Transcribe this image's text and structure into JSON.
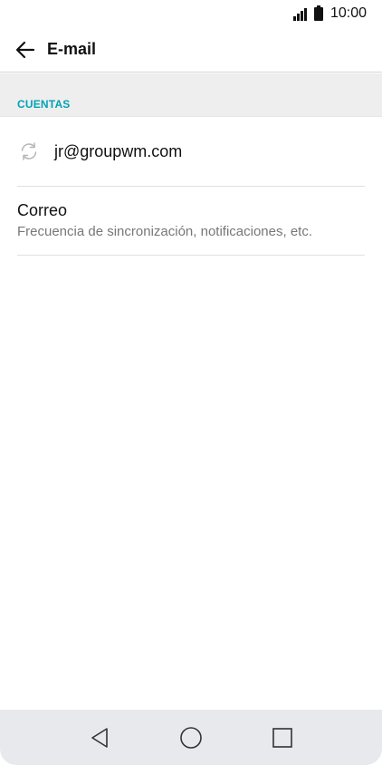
{
  "status_bar": {
    "time": "10:00",
    "icons": [
      "signal-icon",
      "battery-icon"
    ]
  },
  "app_bar": {
    "back_icon": "arrow-left-icon",
    "title": "E-mail"
  },
  "section": {
    "header": "CUENTAS"
  },
  "account": {
    "icon": "sync-icon",
    "email": "jr@groupwm.com"
  },
  "mail_settings": {
    "title": "Correo",
    "subtitle": "Frecuencia de sincronización, notificaciones, etc."
  },
  "nav_bar": {
    "buttons": [
      "back-triangle-icon",
      "home-circle-icon",
      "recents-square-icon"
    ]
  },
  "colors": {
    "accent": "#00a3b4",
    "section_bg": "#eeeeee",
    "nav_bg": "#e8e9ec",
    "subtitle": "#777777"
  }
}
